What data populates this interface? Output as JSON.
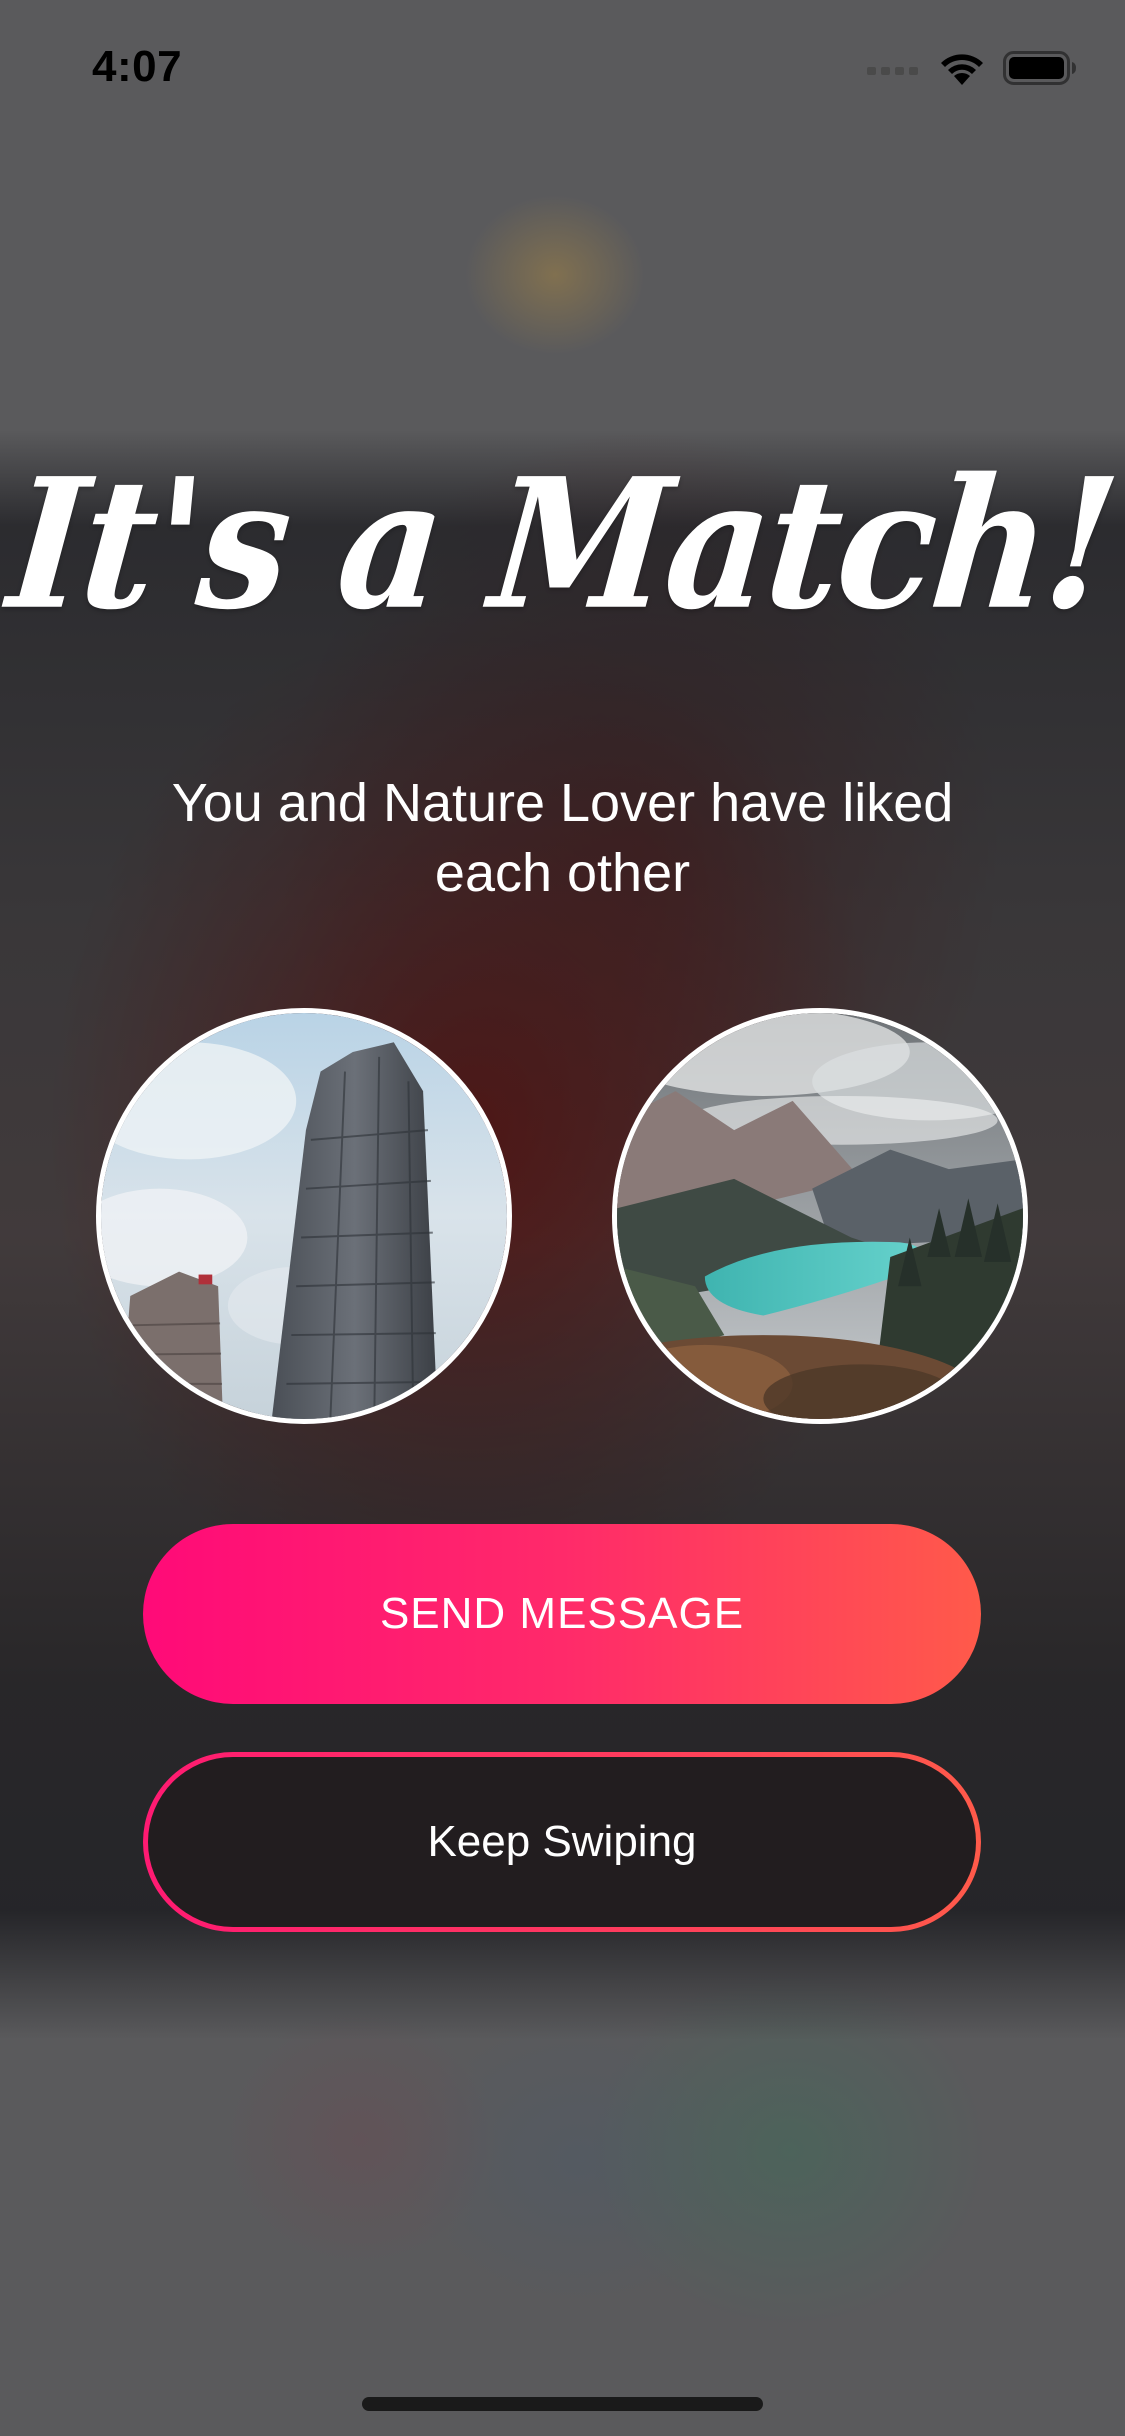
{
  "status_bar": {
    "time": "4:07",
    "icons": [
      "cellular-signal-icon",
      "wifi-icon",
      "battery-icon"
    ]
  },
  "match": {
    "title": "It's a Match!",
    "subtitle": "You and Nature Lover have liked each other"
  },
  "avatars": [
    {
      "name": "my-profile-photo",
      "depicts": "skyscrapers"
    },
    {
      "name": "match-profile-photo",
      "depicts": "mountain lake"
    }
  ],
  "buttons": {
    "send_message": "SEND MESSAGE",
    "keep_swiping": "Keep Swiping"
  },
  "colors": {
    "gradient_start": "#ff0a78",
    "gradient_end": "#ff5a4a",
    "text": "#ffffff"
  }
}
